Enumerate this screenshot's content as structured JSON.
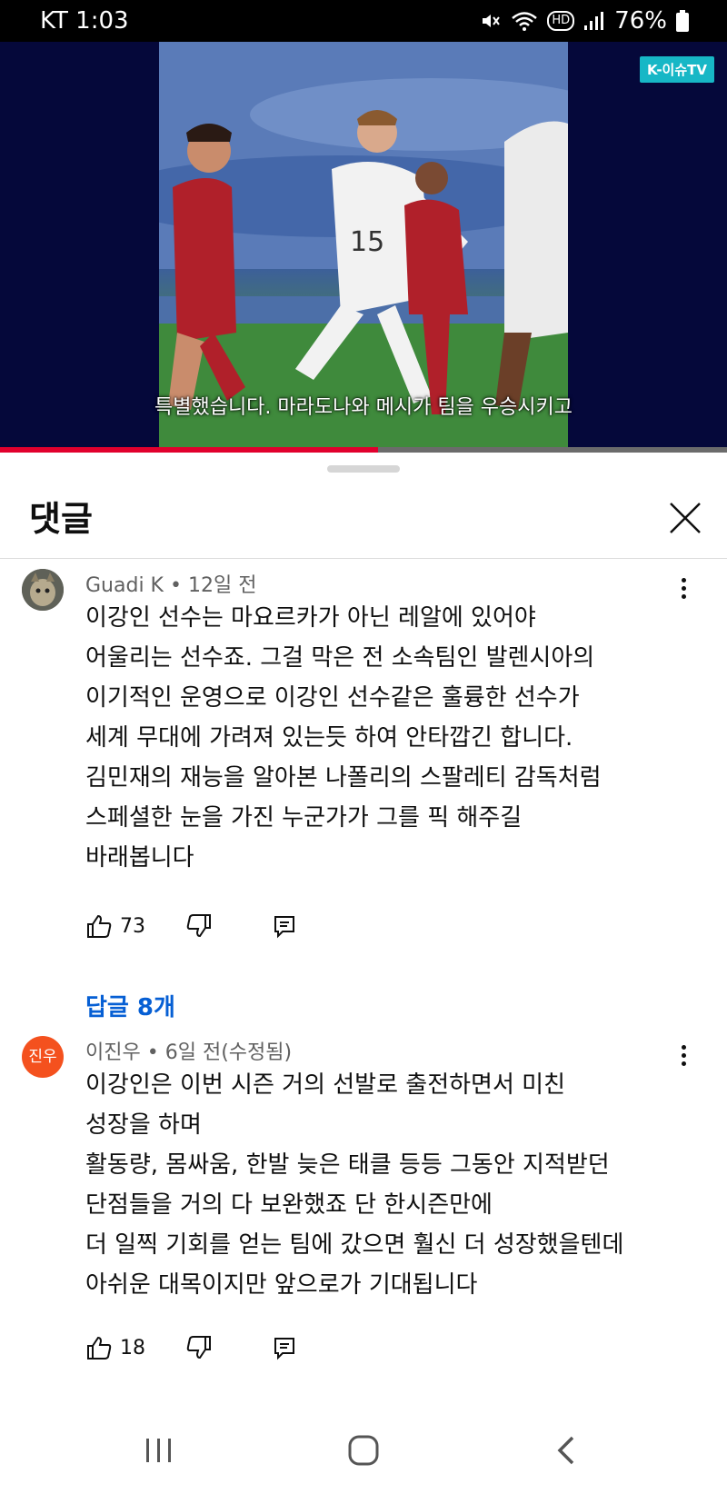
{
  "status_bar": {
    "carrier": "KT 1:03",
    "battery": "76%",
    "hd_label": "HD"
  },
  "video": {
    "channel_logo": "K-이슈TV",
    "subtitle": "특별했습니다. 마라도나와 메시가 팀을 우승시키고",
    "progress": 0.52,
    "colors": {
      "progress": "#e1002d",
      "letterbox": "#05083a"
    }
  },
  "comments_sheet": {
    "title": "댓글",
    "comments": [
      {
        "author": "Guadi K",
        "time": "12일 전",
        "lines": [
          "이강인 선수는 마요르카가 아닌 레알에 있어야",
          "어울리는 선수죠. 그걸 막은 전 소속팀인 발렌시아의",
          "이기적인 운영으로 이강인 선수같은 훌륭한 선수가",
          "세계 무대에 가려져 있는듯 하여 안타깝긴 합니다.",
          "김민재의 재능을 알아본 나폴리의 스팔레티 감독처럼",
          "스페셜한 눈을 가진 누군가가 그를 픽 해주길",
          "바래봅니다"
        ],
        "likes": "73",
        "replies_label": "답글 8개"
      },
      {
        "author": "이진우",
        "time": "6일 전(수정됨)",
        "avatar_text": "진우",
        "avatar_color": "#f4511e",
        "lines": [
          "이강인은 이번 시즌 거의 선발로 출전하면서 미친",
          "성장을 하며",
          "활동량, 몸싸움, 한발 늦은 태클 등등 그동안 지적받던",
          "단점들을 거의 다 보완했죠 단 한시즌만에",
          "더 일찍 기회를 얻는 팀에 갔으면 훨신 더 성장했을텐데",
          "아쉬운 대목이지만 앞으로가 기대됩니다"
        ],
        "likes": "18"
      }
    ]
  },
  "icons": [
    "mute-icon",
    "wifi-icon",
    "signal-icon",
    "battery-icon",
    "close-icon",
    "more-vert-icon",
    "thumb-up-icon",
    "thumb-down-icon",
    "reply-icon",
    "recent-apps-icon",
    "home-icon",
    "back-icon"
  ]
}
